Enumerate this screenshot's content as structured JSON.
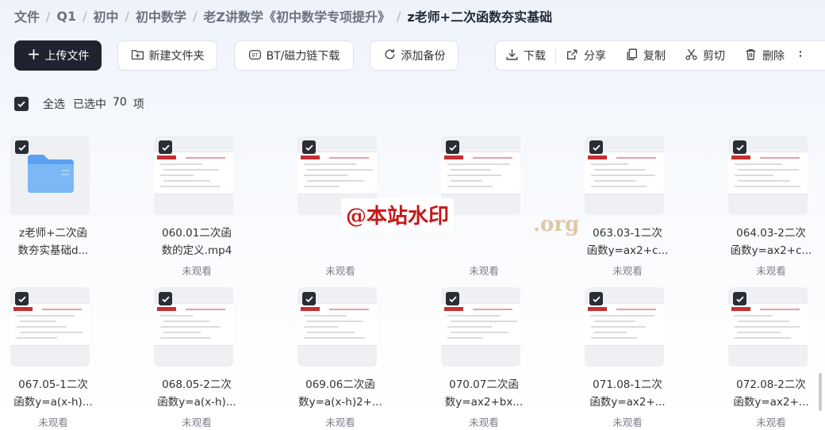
{
  "breadcrumb": [
    "文件",
    "Q1",
    "初中",
    "初中数学",
    "老Z讲数学《初中数学专项提升》",
    "z老师+二次函数夯实基础"
  ],
  "toolbar": {
    "upload": "上传文件",
    "new_folder": "新建文件夹",
    "bt": "BT/磁力链下载",
    "backup": "添加备份",
    "download": "下载",
    "share": "分享",
    "copy": "复制",
    "cut": "剪切",
    "delete": "删除"
  },
  "selection": {
    "select_all": "全选",
    "selected_prefix": "已选中",
    "count": "70",
    "unit": "项"
  },
  "files": [
    {
      "line1": "z老师+二次函",
      "line2": "数夯实基础d...",
      "status": "",
      "kind": "folder"
    },
    {
      "line1": "060.01二次函",
      "line2": "数的定义.mp4",
      "status": "未观看",
      "kind": "video"
    },
    {
      "line1": "",
      "line2": "",
      "status": "未观看",
      "kind": "video"
    },
    {
      "line1": "",
      "line2": "",
      "status": "未观看",
      "kind": "video"
    },
    {
      "line1": "063.03-1二次",
      "line2": "函数y=ax2+c...",
      "status": "未观看",
      "kind": "video"
    },
    {
      "line1": "064.03-2二次",
      "line2": "函数y=ax2+c...",
      "status": "未观看",
      "kind": "video"
    },
    {
      "line1": "067.05-1二次",
      "line2": "函数y=a(x-h)...",
      "status": "未观看",
      "kind": "video"
    },
    {
      "line1": "068.05-2二次",
      "line2": "函数y=a(x-h)...",
      "status": "未观看",
      "kind": "video"
    },
    {
      "line1": "069.06二次函",
      "line2": "数y=a(x-h)2+...",
      "status": "未观看",
      "kind": "video"
    },
    {
      "line1": "070.07二次函",
      "line2": "数y=ax2+bx...",
      "status": "未观看",
      "kind": "video"
    },
    {
      "line1": "071.08-1二次",
      "line2": "函数y=ax2+...",
      "status": "未观看",
      "kind": "video"
    },
    {
      "line1": "072.08-2二次",
      "line2": "函数y=ax2+...",
      "status": "未观看",
      "kind": "video"
    }
  ],
  "watermark": {
    "text": "@本站水印",
    "partial": ".org"
  },
  "colors": {
    "primary": "#1f2330",
    "folder": "#6aaef2",
    "watermark": "#c41818"
  }
}
